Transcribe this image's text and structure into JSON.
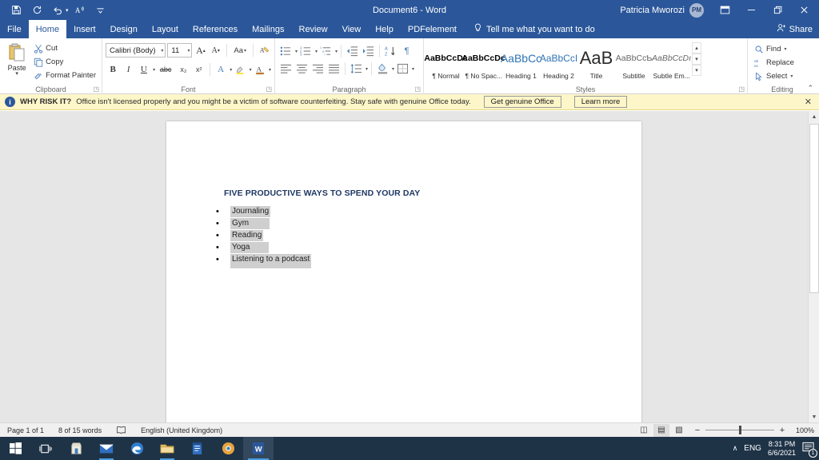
{
  "titlebar": {
    "document_title": "Document6  -  Word",
    "account_name": "Patricia Mworozi",
    "avatar_initials": "PM",
    "quick_access": [
      {
        "name": "save-icon",
        "label": "Save"
      },
      {
        "name": "repeat-icon",
        "label": "Repeat"
      },
      {
        "name": "undo-icon",
        "label": "Undo"
      },
      {
        "name": "read-aloud-icon",
        "label": "Read Aloud"
      },
      {
        "name": "customize-quick-access-icon",
        "label": "Customize Quick Access Toolbar"
      }
    ],
    "window_controls": {
      "ribbon_display": "Ribbon Display Options",
      "minimize": "—",
      "restore": "❐",
      "close": "✕"
    }
  },
  "tabs": [
    {
      "label": "File",
      "active": false
    },
    {
      "label": "Home",
      "active": true
    },
    {
      "label": "Insert",
      "active": false
    },
    {
      "label": "Design",
      "active": false
    },
    {
      "label": "Layout",
      "active": false
    },
    {
      "label": "References",
      "active": false
    },
    {
      "label": "Mailings",
      "active": false
    },
    {
      "label": "Review",
      "active": false
    },
    {
      "label": "View",
      "active": false
    },
    {
      "label": "Help",
      "active": false
    },
    {
      "label": "PDFelement",
      "active": false
    }
  ],
  "tell_me": {
    "placeholder": "Tell me what you want to do",
    "icon": "lightbulb-icon"
  },
  "share": {
    "label": "Share",
    "icon": "share-person-icon"
  },
  "ribbon": {
    "clipboard": {
      "group_label": "Clipboard",
      "paste": "Paste",
      "cut": "Cut",
      "copy": "Copy",
      "format_painter": "Format Painter"
    },
    "font": {
      "group_label": "Font",
      "font_name": "Calibri (Body)",
      "font_size": "11",
      "grow_font": "A",
      "shrink_font": "A",
      "change_case": "Aa",
      "clear_formatting": "Clear All Formatting",
      "bold": "B",
      "italic": "I",
      "underline": "U",
      "strikethrough": "abc",
      "subscript": "x₂",
      "superscript": "x²",
      "text_effects": "A",
      "text_highlight": "Text Highlight Colour",
      "font_color": "A"
    },
    "paragraph": {
      "group_label": "Paragraph",
      "bullets": "Bullets",
      "numbering": "Numbering",
      "multilevel_list": "Multilevel List",
      "decrease_indent": "Decrease Indent",
      "increase_indent": "Increase Indent",
      "sort": "Sort",
      "show_marks": "¶",
      "align_left": "Align Left",
      "center": "Center",
      "align_right": "Align Right",
      "justify": "Justify",
      "line_spacing": "Line and Paragraph Spacing",
      "shading": "Shading",
      "borders": "Borders"
    },
    "styles": {
      "group_label": "Styles",
      "items": [
        {
          "preview": "AaBbCcDc",
          "name": "¶ Normal"
        },
        {
          "preview": "AaBbCcDc",
          "name": "¶ No Spac..."
        },
        {
          "preview": "AaBbCс",
          "name": "Heading 1"
        },
        {
          "preview": "AaBbCcІ",
          "name": "Heading 2"
        },
        {
          "preview": "AaB",
          "name": "Title"
        },
        {
          "preview": "AaBbCcƄ",
          "name": "Subtitle"
        },
        {
          "preview": "AaBbCcDı",
          "name": "Subtle Em..."
        }
      ]
    },
    "editing": {
      "group_label": "Editing",
      "find": "Find",
      "replace": "Replace",
      "select": "Select"
    }
  },
  "banner": {
    "icon": "info-icon",
    "headline": "WHY RISK IT?",
    "message": "Office isn't licensed properly and you might be a victim of software counterfeiting. Stay safe with genuine Office today.",
    "primary_button": "Get genuine Office",
    "secondary_button": "Learn more",
    "close": "✕"
  },
  "document": {
    "title": "FIVE PRODUCTIVE WAYS TO SPEND YOUR DAY",
    "bullets": [
      "Journaling",
      "Gym",
      "Reading",
      "Yoga",
      "Listening to a podcast"
    ],
    "bullet_glyph": "•"
  },
  "statusbar": {
    "page": "Page 1 of 1",
    "words": "8 of 15 words",
    "proofing_icon": "proofing-errors-icon",
    "language": "English (United Kingdom)",
    "views": [
      {
        "name": "read-mode-view-button",
        "glyph": "◫",
        "active": false
      },
      {
        "name": "print-layout-view-button",
        "glyph": "▤",
        "active": true
      },
      {
        "name": "web-layout-view-button",
        "glyph": "▧",
        "active": false
      }
    ],
    "zoom_out": "−",
    "zoom_in": "+",
    "zoom_level": "100%"
  },
  "taskbar": {
    "items": [
      {
        "name": "start-button",
        "label": "Start"
      },
      {
        "name": "task-view-button",
        "label": "Task View"
      },
      {
        "name": "microsoft-store-icon",
        "label": "Microsoft Store"
      },
      {
        "name": "mail-icon",
        "label": "Mail"
      },
      {
        "name": "edge-icon",
        "label": "Microsoft Edge"
      },
      {
        "name": "file-explorer-icon",
        "label": "File Explorer"
      },
      {
        "name": "onenote-icon",
        "label": "OneNote"
      },
      {
        "name": "chrome-icon",
        "label": "Google Chrome"
      },
      {
        "name": "word-icon",
        "label": "Word"
      }
    ],
    "tray": {
      "show_hidden": "∧",
      "language": "ENG",
      "time": "8:31 PM",
      "date": "6/6/2021",
      "notification_count": "1"
    }
  },
  "colors": {
    "word_blue": "#2b579a",
    "banner_yellow": "#fdf6c8",
    "selection_gray": "#cfcfcf",
    "heading_navy": "#1f3864",
    "taskbar": "#1f3347"
  }
}
